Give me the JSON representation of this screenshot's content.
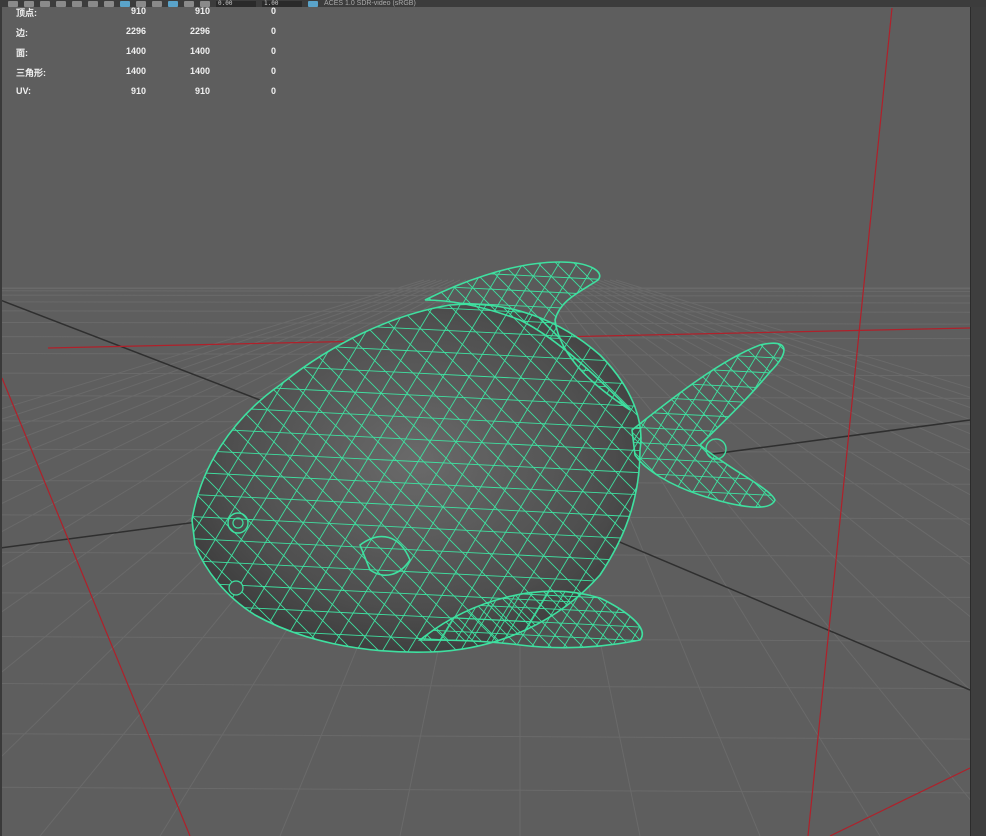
{
  "toolbar": {
    "camera_field": "0.00",
    "gamma_field": "1.00",
    "color_space_label": "ACES 1.0 SDR-video (sRGB)"
  },
  "hud": {
    "rows": [
      {
        "label": "顶点:",
        "v1": "910",
        "v2": "910",
        "v3": "0"
      },
      {
        "label": "边:",
        "v1": "2296",
        "v2": "2296",
        "v3": "0"
      },
      {
        "label": "面:",
        "v1": "1400",
        "v2": "1400",
        "v3": "0"
      },
      {
        "label": "三角形:",
        "v1": "1400",
        "v2": "1400",
        "v3": "0"
      },
      {
        "label": "UV:",
        "v1": "910",
        "v2": "910",
        "v3": "0"
      }
    ]
  },
  "colors": {
    "background": "#5e5e5e",
    "grid": "#6a6a6a",
    "grid_axis": "#2f2f2f",
    "axis_red": "#b0202a",
    "wire": "#3fe0a0",
    "fish_fill": "#555555"
  },
  "icons": [
    "select-icon",
    "lasso-icon",
    "paint-icon",
    "move-icon",
    "rotate-icon",
    "scale-icon",
    "grid-icon",
    "shade-icon",
    "wireframe-icon",
    "texture-icon",
    "light-icon",
    "shadow-icon",
    "camera-icon",
    "color-space-icon"
  ]
}
